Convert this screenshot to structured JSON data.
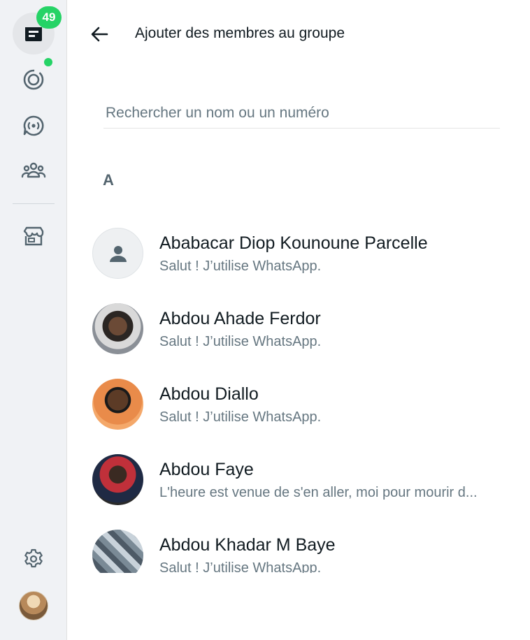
{
  "rail": {
    "chats_badge": "49",
    "items": [
      {
        "icon": "chats-icon",
        "active": true
      },
      {
        "icon": "status-icon"
      },
      {
        "icon": "channels-icon"
      },
      {
        "icon": "communities-icon"
      },
      {
        "icon": "store-icon"
      },
      {
        "icon": "settings-icon"
      },
      {
        "icon": "profile-avatar"
      }
    ],
    "accent": "#25d366"
  },
  "header": {
    "title": "Ajouter des membres au groupe"
  },
  "search": {
    "placeholder": "Rechercher un nom ou un numéro",
    "value": ""
  },
  "section_letter": "A",
  "contacts": [
    {
      "name": "Ababacar Diop Kounoune Parcelle",
      "status": "Salut ! J’utilise WhatsApp."
    },
    {
      "name": "Abdou Ahade Ferdor",
      "status": "Salut ! J’utilise WhatsApp."
    },
    {
      "name": "Abdou Diallo",
      "status": "Salut ! J’utilise WhatsApp."
    },
    {
      "name": "Abdou Faye",
      "status": "L'heure est venue de s'en aller, moi pour mourir d..."
    },
    {
      "name": "Abdou Khadar M Baye",
      "status": "Salut ! J’utilise WhatsApp."
    }
  ]
}
